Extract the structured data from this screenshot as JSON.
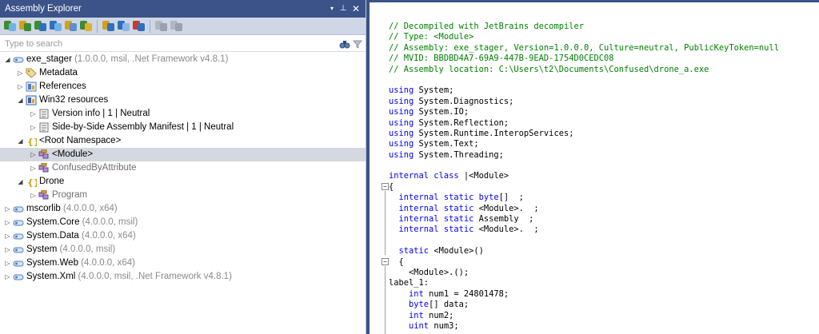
{
  "panel": {
    "title": "Assembly Explorer",
    "dropdown_glyph": "▾",
    "pin_glyph": "⊥",
    "close_glyph": "✕"
  },
  "toolbar": {
    "icons": [
      "open-assembly-icon",
      "open-folder-icon",
      "open-nuget-icon",
      "open-from-gac-icon",
      "assembly-list-icon",
      "search-settings-icon",
      "show-types-icon",
      "hierarchy-icon",
      "remove-assembly-icon",
      "export-project-icon",
      "export-solution-icon"
    ]
  },
  "search": {
    "placeholder": "Type to search",
    "icons": [
      "binoculars-icon",
      "filter-icon"
    ]
  },
  "tree": {
    "nodes": [
      {
        "label": "exe_stager",
        "meta": " (1.0.0.0, msil, .Net Framework v4.8.1)",
        "icon": "assembly-icon",
        "expander": "◢"
      },
      {
        "label": "Metadata",
        "icon": "tag-icon",
        "expander": "▷"
      },
      {
        "label": "References",
        "icon": "references-icon",
        "expander": "▷"
      },
      {
        "label": "Win32 resources",
        "icon": "resources-icon",
        "expander": "◢"
      },
      {
        "label": "Version info | 1 | Neutral",
        "icon": "document-icon",
        "expander": "▷"
      },
      {
        "label": "Side-by-Side Assembly Manifest | 1 | Neutral",
        "icon": "document-icon",
        "expander": "▷"
      },
      {
        "label": "<Root Namespace>",
        "icon": "namespace-icon",
        "expander": "◢"
      },
      {
        "label": "<Module>",
        "icon": "class-icon",
        "expander": "▷"
      },
      {
        "label": "ConfusedByAttribute",
        "icon": "class-icon",
        "expander": "▷"
      },
      {
        "label": "Drone",
        "icon": "namespace-icon",
        "expander": "◢"
      },
      {
        "label": "Program",
        "icon": "class-icon",
        "expander": "▷"
      },
      {
        "label": "mscorlib",
        "meta": " (4.0.0.0, x64)",
        "icon": "assembly-icon",
        "expander": "▷"
      },
      {
        "label": "System.Core",
        "meta": " (4.0.0.0, msil)",
        "icon": "assembly-icon",
        "expander": "▷"
      },
      {
        "label": "System.Data",
        "meta": " (4.0.0.0, x64)",
        "icon": "assembly-icon",
        "expander": "▷"
      },
      {
        "label": "System",
        "meta": " (4.0.0.0, msil)",
        "icon": "assembly-icon",
        "expander": "▷"
      },
      {
        "label": "System.Web",
        "meta": " (4.0.0.0, x64)",
        "icon": "assembly-icon",
        "expander": "▷"
      },
      {
        "label": "System.Xml",
        "meta": " (4.0.0.0, msil, .Net Framework v4.8.1)",
        "icon": "assembly-icon",
        "expander": "▷"
      }
    ]
  },
  "code": {
    "lines": [
      {
        "parts": [
          {
            "t": "// Decompiled with JetBrains decompiler",
            "c": "cm"
          }
        ]
      },
      {
        "parts": [
          {
            "t": "// Type: <Module>",
            "c": "cm"
          }
        ]
      },
      {
        "parts": [
          {
            "t": "// Assembly: exe_stager, Version=1.0.0.0, Culture=neutral, PublicKeyToken=null",
            "c": "cm"
          }
        ]
      },
      {
        "parts": [
          {
            "t": "// MVID: BBDBD4A7-69A9-447B-9EAD-1754D0CEDC08",
            "c": "cm"
          }
        ]
      },
      {
        "parts": [
          {
            "t": "// Assembly location: C:\\Users\\t2\\Documents\\Confused\\drone_a.exe",
            "c": "cm"
          }
        ]
      },
      {
        "parts": []
      },
      {
        "parts": [
          {
            "t": "using",
            "c": "kw"
          },
          {
            "t": " System;"
          }
        ]
      },
      {
        "parts": [
          {
            "t": "using",
            "c": "kw"
          },
          {
            "t": " System.Diagnostics;"
          }
        ]
      },
      {
        "parts": [
          {
            "t": "using",
            "c": "kw"
          },
          {
            "t": " System.IO;"
          }
        ]
      },
      {
        "parts": [
          {
            "t": "using",
            "c": "kw"
          },
          {
            "t": " System.Reflection;"
          }
        ]
      },
      {
        "parts": [
          {
            "t": "using",
            "c": "kw"
          },
          {
            "t": " System.Runtime.InteropServices;"
          }
        ]
      },
      {
        "parts": [
          {
            "t": "using",
            "c": "kw"
          },
          {
            "t": " System.Text;"
          }
        ]
      },
      {
        "parts": [
          {
            "t": "using",
            "c": "kw"
          },
          {
            "t": " System.Threading;"
          }
        ]
      },
      {
        "parts": []
      },
      {
        "parts": [
          {
            "t": "internal class",
            "c": "kw"
          },
          {
            "t": " |<Module>"
          }
        ]
      },
      {
        "parts": [
          {
            "t": "{"
          }
        ]
      },
      {
        "parts": [
          {
            "t": "  "
          },
          {
            "t": "internal static",
            "c": "kw"
          },
          {
            "t": " "
          },
          {
            "t": "byte",
            "c": "kw"
          },
          {
            "t": "[]  ;"
          }
        ]
      },
      {
        "parts": [
          {
            "t": "  "
          },
          {
            "t": "internal static",
            "c": "kw"
          },
          {
            "t": " <Module>.  ;"
          }
        ]
      },
      {
        "parts": [
          {
            "t": "  "
          },
          {
            "t": "internal static",
            "c": "kw"
          },
          {
            "t": " Assembly  ;"
          }
        ]
      },
      {
        "parts": [
          {
            "t": "  "
          },
          {
            "t": "internal static",
            "c": "kw"
          },
          {
            "t": " <Module>.  ;"
          }
        ]
      },
      {
        "parts": []
      },
      {
        "parts": [
          {
            "t": "  "
          },
          {
            "t": "static",
            "c": "kw"
          },
          {
            "t": " <Module>()"
          }
        ]
      },
      {
        "parts": [
          {
            "t": "  {"
          }
        ]
      },
      {
        "parts": [
          {
            "t": "    <Module>.();"
          }
        ]
      },
      {
        "parts": [
          {
            "t": "label_1:"
          }
        ]
      },
      {
        "parts": [
          {
            "t": "    "
          },
          {
            "t": "int",
            "c": "kw"
          },
          {
            "t": " num1 = 24801478;"
          }
        ]
      },
      {
        "parts": [
          {
            "t": "    "
          },
          {
            "t": "byte",
            "c": "kw"
          },
          {
            "t": "[] data;"
          }
        ]
      },
      {
        "parts": [
          {
            "t": "    "
          },
          {
            "t": "int",
            "c": "kw"
          },
          {
            "t": " num2;"
          }
        ]
      },
      {
        "parts": [
          {
            "t": "    "
          },
          {
            "t": "uint",
            "c": "kw"
          },
          {
            "t": " num3;"
          }
        ]
      }
    ]
  }
}
